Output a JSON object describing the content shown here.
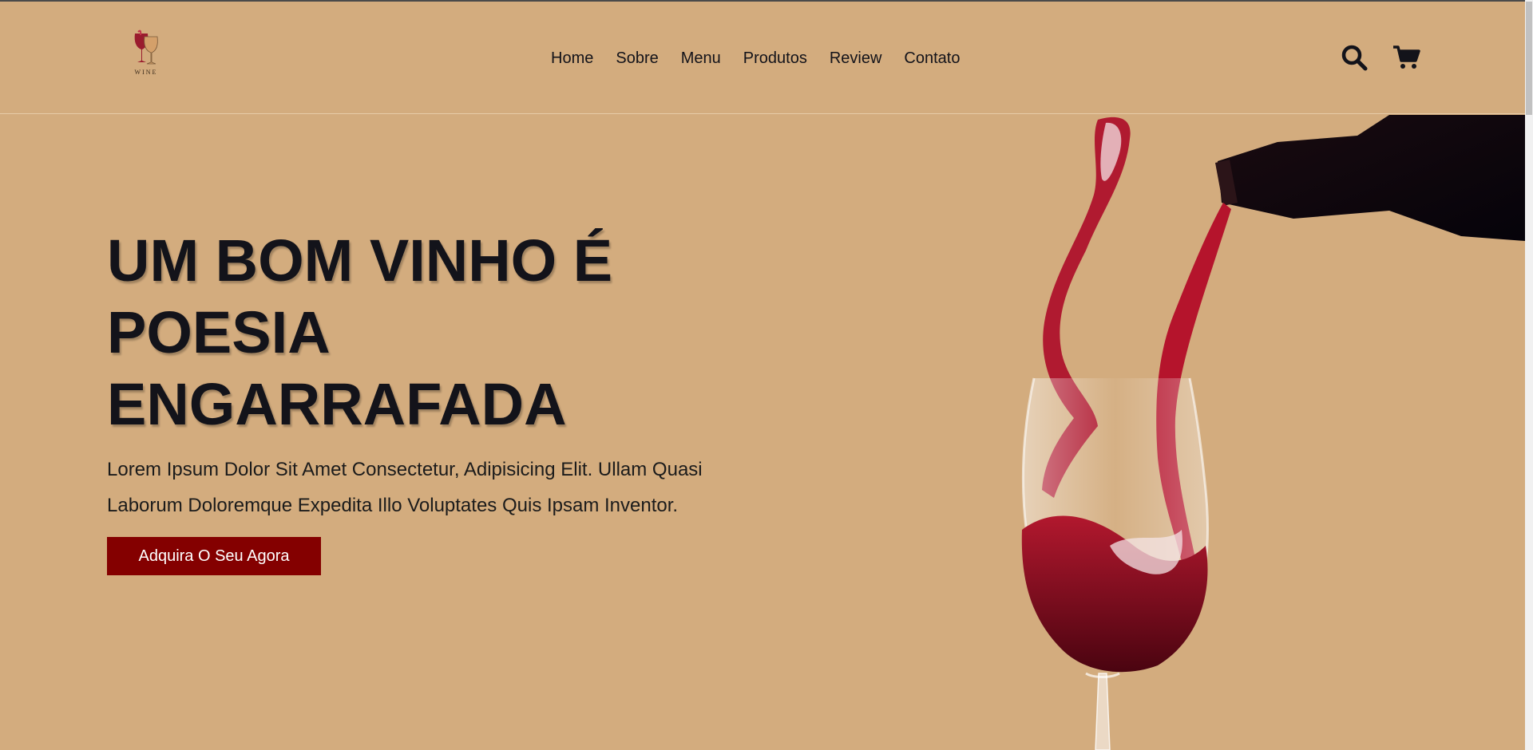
{
  "brand": {
    "logo_text": "WINE",
    "colors": {
      "background": "#d3ac7e",
      "accent": "#840000",
      "text": "#13131a"
    }
  },
  "nav": {
    "items": [
      "Home",
      "Sobre",
      "Menu",
      "Produtos",
      "Review",
      "Contato"
    ]
  },
  "header_icons": [
    {
      "name": "search-icon"
    },
    {
      "name": "cart-icon"
    }
  ],
  "hero": {
    "title_lines": [
      "UM BOM VINHO É",
      "POESIA",
      "ENGARRAFADA"
    ],
    "description": "Lorem Ipsum Dolor Sit Amet Consectetur, Adipisicing Elit. Ullam Quasi Laborum Doloremque Expedita Illo Voluptates Quis Ipsam Inventor.",
    "cta_label": "Adquira O Seu Agora"
  }
}
